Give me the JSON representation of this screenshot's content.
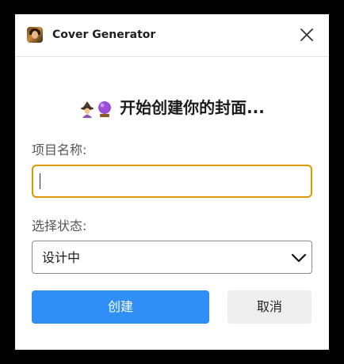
{
  "window": {
    "title": "Cover Generator",
    "app_icon": "portrait-icon",
    "close_icon": "close-icon"
  },
  "heading": {
    "emoji_1": "mage-icon",
    "emoji_2": "crystal-ball-icon",
    "text": "开始创建你的封面..."
  },
  "form": {
    "name_label": "项目名称:",
    "name_value": "",
    "status_label": "选择状态:",
    "status_selected": "设计中"
  },
  "buttons": {
    "create_label": "创建",
    "cancel_label": "取消"
  },
  "colors": {
    "primary": "#2f8ff7",
    "focus_border": "#d99a00",
    "secondary_bg": "#eeeeee"
  }
}
